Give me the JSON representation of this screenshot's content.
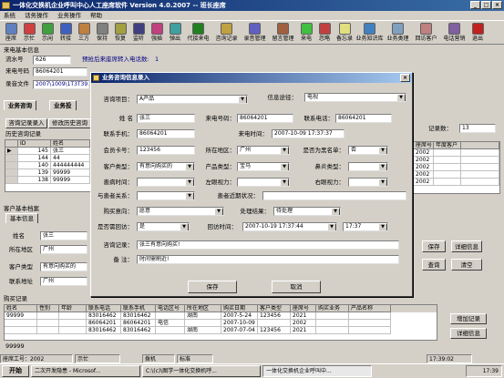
{
  "window": {
    "title": "一体化交换机企业呼叫中心人工座席软件 Version 4.0.2007 -- 班长座席"
  },
  "menu": [
    "系统",
    "话务操作",
    "业务操作",
    "帮助"
  ],
  "toolbar": [
    "座席",
    "示忙",
    "示闲",
    "转接",
    "三方",
    "保持",
    "恢复",
    "监听",
    "强插",
    "弹出",
    "代接来电",
    "咨询记录",
    "录音管理",
    "留言管理",
    "来电",
    "忽略",
    "备忘录",
    "业务知识库",
    "业务类理",
    "回访客户",
    "电话营销",
    "退出"
  ],
  "left": {
    "box_label": "来电基本信息",
    "flow_label": "流水号",
    "flow_value": "626",
    "caller_label": "来电号码",
    "caller_value": "86064201",
    "record_label": "录音文件",
    "record_value": "2007\\1009\\1T3T39.02\\",
    "wait_text": "预抢后来座席转入电话数:",
    "wait_value": "1",
    "tab1": "业务咨询",
    "tab2": "业务投",
    "btn_consult": "咨询记录录入",
    "btn_modify": "修改历史咨询",
    "history_label": "历史咨询记录",
    "history_headers": [
      "ID",
      "姓名"
    ],
    "history_rows": [
      [
        "145",
        "张三"
      ],
      [
        "144",
        "44"
      ],
      [
        "140",
        "444444444"
      ],
      [
        "139",
        "99999"
      ],
      [
        "138",
        "99999"
      ]
    ],
    "cust_label": "客户基本档案",
    "cust_tab": "基本信息",
    "name_label": "姓名",
    "name_value": "张三",
    "region_label": "所在地区",
    "region_value": "广州",
    "ctype_label": "客户类型",
    "ctype_value": "有意向购买的",
    "addr_label": "联系地址",
    "addr_value": "广州"
  },
  "right": {
    "count_label": "记录数：",
    "count_value": "13",
    "headers": [
      "座席号",
      "序号",
      "年龄",
      "有效记录",
      "满意度",
      "有效访问",
      "座席号",
      "年",
      "年度客户"
    ],
    "rows": [
      [
        "2002",
        ""
      ],
      [
        "2002",
        ""
      ],
      [
        "2002",
        ""
      ],
      [
        "2002",
        ""
      ],
      [
        "2002",
        ""
      ]
    ],
    "btn_save": "保存",
    "btn_detail": "详细信息",
    "btn_query": "查询",
    "btn_clear": "清空"
  },
  "purchase": {
    "label": "购买记录",
    "headers": [
      "姓名",
      "性别",
      "年龄",
      "联系电话",
      "联系手机",
      "电话区号",
      "所在地区",
      "购买日期",
      "客户类型",
      "座席号",
      "购买业务",
      "产品名称"
    ],
    "rows": [
      [
        "99999",
        "",
        "",
        "83016462",
        "83016462",
        "",
        "湖南",
        "2007-5-24",
        "123456",
        "2021",
        ""
      ],
      [
        "",
        "",
        "",
        "86064201",
        "86064201",
        "电信",
        "",
        "2007-10-09",
        "",
        "2002",
        ""
      ],
      [
        "",
        "",
        "",
        "83016462",
        "83016462",
        "",
        "湖南",
        "2007-07-04",
        "123456",
        "2021",
        ""
      ]
    ],
    "btn_add": "增加记录",
    "btn_detail": "详细信息",
    "extra_label": "99999"
  },
  "dialog": {
    "title": "业务咨询信息录入",
    "fields": {
      "item_label": "咨询项目：",
      "item_value": "A产品",
      "channel_label": "信息途径：",
      "channel_value": "电视",
      "name_label": "姓    名",
      "name_value": "张三",
      "caller_label": "来电号码：",
      "caller_value": "86064201",
      "contact_label": "联系电话：",
      "contact_value": "86064201",
      "phone_label": "联系手机：",
      "phone_value": "86064201",
      "time_label": "来电时间：",
      "time_value": "2007-10-09 17:37:37",
      "member_label": "会员卡号：",
      "member_value": "123456",
      "region_label": "所在地区：",
      "region_value": "广州",
      "blacklist_label": "是否为黑名单：",
      "blacklist_value": "否",
      "ctype_label": "客户类型：",
      "ctype_value": "有意向购买的",
      "ptype_label": "产品类型：",
      "ptype_value": "宝马",
      "skin_label": "鼻炎类型：",
      "skin_value": "",
      "illness_label": "患病时间：",
      "illness_value": "",
      "left_label": "左眼视力：",
      "left_value": "",
      "right_label": "右眼视力：",
      "right_value": "",
      "relation_label": "与患者关系：",
      "relation_value": "",
      "recent_label": "患者近期状况：",
      "recent_value": "",
      "intent_label": "购买意向：",
      "intent_value": "愿意",
      "result_label": "处理结果：",
      "result_value": "待处理",
      "revisit_label": "是否需回访：",
      "revisit_value": "是",
      "revtime_label": "回访时间：",
      "revtime_date": "2007-10-19 17:37:44",
      "revtime_value": "17:37",
      "record_label": "咨询记录：",
      "record_value": "张三有意向购买!",
      "note_label": "备    注：",
      "note_value": "时间需刷近!"
    },
    "btn_save": "保存",
    "btn_cancel": "取消"
  },
  "status": {
    "seat": "座席工号：2002",
    "state": "示忙",
    "dialer": "拨机",
    "sep": "标准",
    "time": "17:39:02"
  },
  "taskbar": {
    "start": "开始",
    "time": "17:39",
    "tasks": [
      "二次开发隐患 - Microsof...",
      "C:\\(c)\\图学一体化交换机呼...",
      "一体化交换机企业呼叫中..."
    ]
  }
}
